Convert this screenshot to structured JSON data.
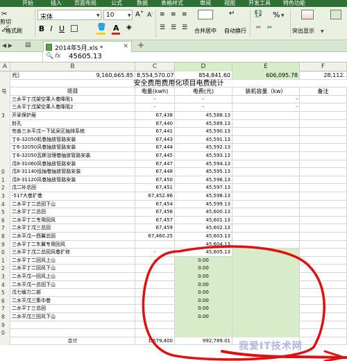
{
  "menubar": {
    "tabs": [
      "开始",
      "插入",
      "页面布局",
      "公式",
      "数据",
      "表格样式",
      "审阅",
      "视图",
      "开发工具",
      "特色功能"
    ],
    "active_tab": "开始"
  },
  "toolbar": {
    "cut_label": "剪切",
    "format_painter_label": "格式刷",
    "font_name": "宋体",
    "font_size": "10",
    "bold": "B",
    "italic": "I",
    "underline": "U",
    "merge_center_label": "合并居中",
    "wrap_text_label": "自动换行",
    "number_format_symbol": "%",
    "highlight_label": "突出显示",
    "colors": {
      "font_color": "#e02020",
      "fill_color": "#ffd200",
      "ribbon": "#2f6f33"
    }
  },
  "tabs": {
    "file_tab_label": "2014年5月.xls *",
    "add_tab": "+"
  },
  "formula_bar": {
    "fx": "fx",
    "value": "45605.13"
  },
  "columns": [
    {
      "name": "A"
    },
    {
      "name": "B"
    },
    {
      "name": "C"
    },
    {
      "name": "D"
    },
    {
      "name": "E"
    },
    {
      "name": "F"
    }
  ],
  "summary_row": {
    "label": "元）",
    "b": "9,160,665.85",
    "c": "8,554,570.07",
    "d": "854,841.60",
    "e": "606,095.78",
    "f": "28,112."
  },
  "table": {
    "title": "安全费用费用化项目电费统计",
    "headers": {
      "a": "号",
      "b": "项目",
      "c": "电量(kwh)",
      "d": "电费(元)",
      "e": "装机容量（kw）",
      "f": "备注"
    },
    "rows": [
      {
        "n": "",
        "b": "三水平丁戊架空乘人巷降阻1",
        "c": "-",
        "d": "-",
        "e": "-"
      },
      {
        "n": "",
        "b": "三水平丁戊架空乘人巷降阻2",
        "c": "-",
        "d": "-",
        "e": "-"
      },
      {
        "n": "3",
        "b": "开采保护层",
        "c": "67,438",
        "d": "45,588.13",
        "e": ""
      },
      {
        "n": "",
        "b": "封孔",
        "c": "67,440",
        "d": "45,589.13",
        "e": ""
      },
      {
        "n": "",
        "b": "完善三水平戊一下延采区抽排系统",
        "c": "67,441",
        "d": "45,590.13",
        "e": ""
      },
      {
        "n": "",
        "b": "丁6-32050机巷抽放管路安装",
        "c": "67,443",
        "d": "45,591.13",
        "e": ""
      },
      {
        "n": "",
        "b": "丁6-32050风巷抽放管路安装",
        "c": "67,444",
        "d": "45,592.13",
        "e": ""
      },
      {
        "n": "",
        "b": "丁6-32050瓦斯治理巷抽放管路安装",
        "c": "67,445",
        "d": "45,593.13",
        "e": ""
      },
      {
        "n": "",
        "b": "戊8-31060风巷抽放管路安装",
        "c": "67,447",
        "d": "45,594.13",
        "e": ""
      },
      {
        "n": "0",
        "b": "戊8-31140低抽巷抽放管路安装",
        "c": "67,448",
        "d": "45,595.13",
        "e": ""
      },
      {
        "n": "1",
        "b": "戊8-31120风巷抽放管路安装",
        "c": "67,450",
        "d": "45,596.13",
        "e": ""
      },
      {
        "n": "2",
        "b": "戊二补总回",
        "c": "67,451",
        "d": "45,597.13",
        "e": ""
      },
      {
        "n": "3",
        "b": "-517大巷扩巷",
        "c": "67,452.86",
        "d": "45,598.13",
        "e": ""
      },
      {
        "n": "4",
        "b": "二水平丁二总回下山",
        "c": "67,454",
        "d": "45,599.13",
        "e": ""
      },
      {
        "n": "5",
        "b": "二水平丁二总回",
        "c": "67,456",
        "d": "45,600.13",
        "e": ""
      },
      {
        "n": "6",
        "b": "二水平丁二专用回风",
        "c": "67,457",
        "d": "45,601.13",
        "e": ""
      },
      {
        "n": "7",
        "b": "二水平丁戊三总回",
        "c": "67,459",
        "d": "45,602.13",
        "e": ""
      },
      {
        "n": "8",
        "b": "二水平戊一西翼总回",
        "c": "67,460.25",
        "d": "45,603.13",
        "e": ""
      },
      {
        "n": "9",
        "b": "三水平丁二东翼专用回风",
        "c": "",
        "d": "45,604.13",
        "e": ""
      },
      {
        "n": "0",
        "b": "三水平丁戊二总回风巷扩修",
        "c": "-",
        "d": "45,605.13",
        "e": ""
      },
      {
        "n": "1",
        "b": "二水平丁二回风上山",
        "c": "-",
        "d": "0.00",
        "e": ""
      },
      {
        "n": "2",
        "b": "二水平丁二回风下山",
        "c": "",
        "d": "0.00",
        "e": ""
      },
      {
        "n": "3",
        "b": "二水平戊一回风上山",
        "c": "",
        "d": "0.00",
        "e": ""
      },
      {
        "n": "4",
        "b": "二水平戊一总回下山",
        "c": "",
        "d": "0.00",
        "e": ""
      },
      {
        "n": "5",
        "b": "戊七缓力二部",
        "c": "",
        "d": "0.00",
        "e": ""
      },
      {
        "n": "6",
        "b": "二水平戊三集中巷",
        "c": "",
        "d": "0.00",
        "e": ""
      },
      {
        "n": "7",
        "b": "二水平丁三总回",
        "c": "",
        "d": "0.00",
        "e": ""
      },
      {
        "n": "8",
        "b": "二水平戊三回风下山",
        "c": "",
        "d": "0.00",
        "e": ""
      },
      {
        "n": "9",
        "b": "",
        "c": "",
        "d": "",
        "e": ""
      },
      {
        "n": "0",
        "b": "",
        "c": "",
        "d": "",
        "e": ""
      }
    ],
    "total_row": {
      "b": "合计",
      "c": "1,679,400",
      "d": "992,789.01",
      "e": ""
    }
  },
  "watermark": "我爱IT技术网",
  "annotation_color": "#e01010"
}
